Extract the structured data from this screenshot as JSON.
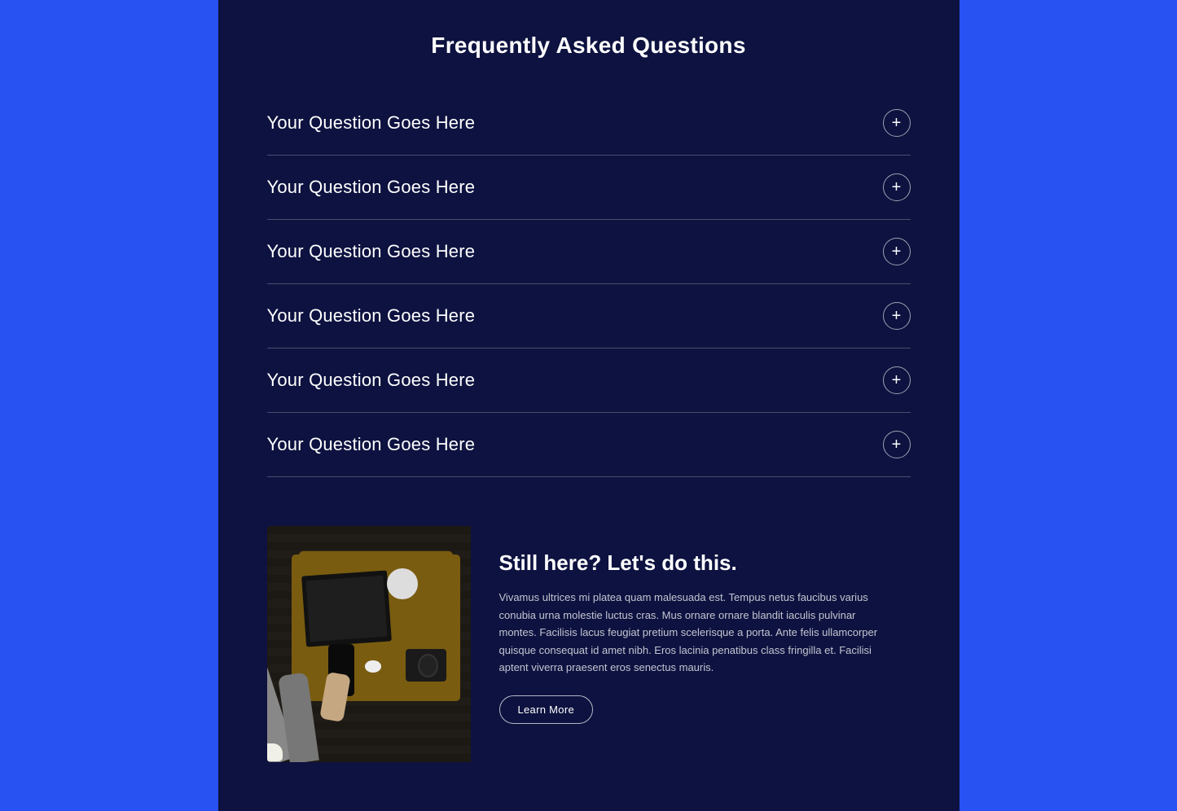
{
  "page": {
    "background_color": "#2952f3",
    "panel_color": "#0d1240"
  },
  "faq": {
    "title": "Frequently Asked Questions",
    "items": [
      {
        "id": 1,
        "question": "Your Question Goes Here",
        "toggle": "+"
      },
      {
        "id": 2,
        "question": "Your Question Goes Here",
        "toggle": "+"
      },
      {
        "id": 3,
        "question": "Your Question Goes Here",
        "toggle": "+"
      },
      {
        "id": 4,
        "question": "Your Question Goes Here",
        "toggle": "+"
      },
      {
        "id": 5,
        "question": "Your Question Goes Here",
        "toggle": "+"
      },
      {
        "id": 6,
        "question": "Your Question Goes Here",
        "toggle": "+"
      }
    ]
  },
  "cta": {
    "heading": "Still here? Let's do this.",
    "body": "Vivamus ultrices mi platea quam malesuada est. Tempus netus faucibus varius conubia urna molestie luctus cras. Mus ornare ornare blandit iaculis pulvinar montes. Facilisis lacus feugiat pretium scelerisque a porta. Ante felis ullamcorper quisque consequat id amet nibh. Eros lacinia penatibus class fringilla et. Facilisi aptent viverra praesent eros senectus mauris.",
    "button_label": "Learn More"
  }
}
